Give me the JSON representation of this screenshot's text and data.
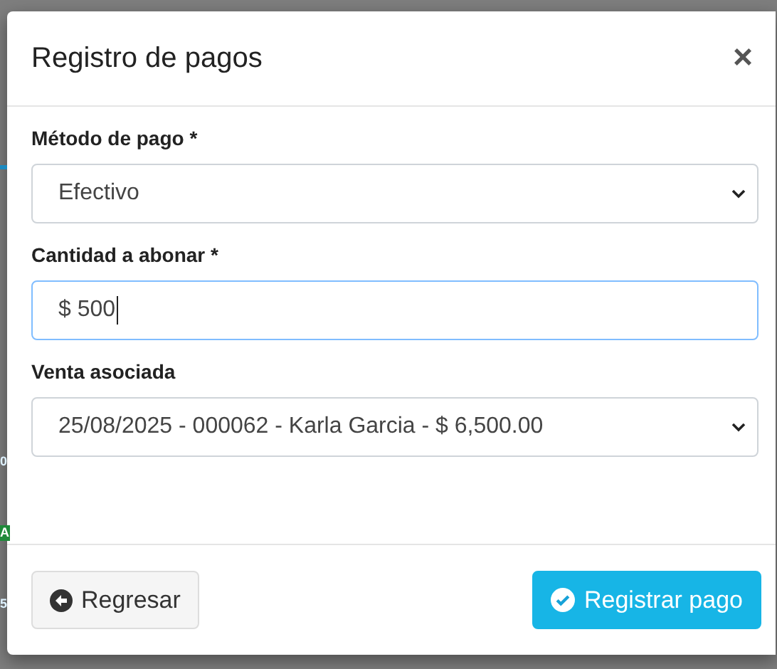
{
  "background": {
    "fragments": [
      "0",
      "A",
      "5"
    ]
  },
  "modal": {
    "title": "Registro de pagos",
    "close": "×",
    "fields": [
      {
        "kind": "select",
        "label": "Método de pago *",
        "value": "Efectivo",
        "focused": false
      },
      {
        "kind": "input",
        "label": "Cantidad a abonar *",
        "value": "$ 500",
        "focused": true
      },
      {
        "kind": "select",
        "label": "Venta asociada",
        "value": "25/08/2025 - 000062 - Karla Garcia - $ 6,500.00",
        "focused": false
      }
    ],
    "buttons": [
      {
        "kind": "back",
        "label": "Regresar"
      },
      {
        "kind": "submit",
        "label": "Registrar pago"
      }
    ]
  }
}
